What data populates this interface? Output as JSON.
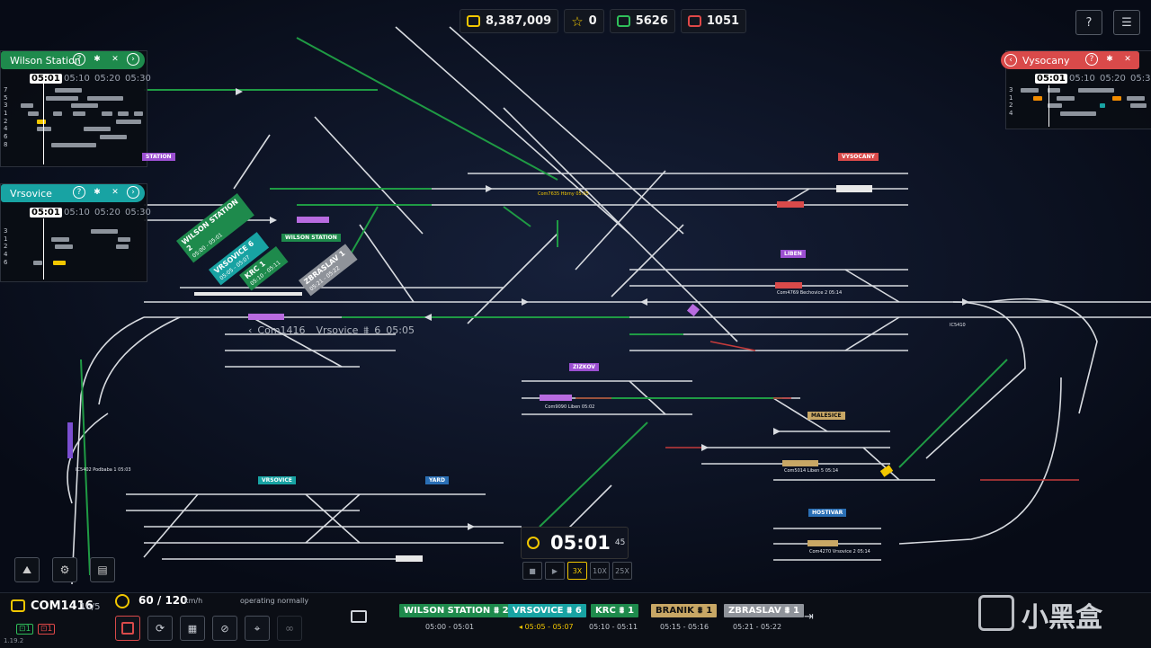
{
  "topbar": {
    "money": "8,387,009",
    "stars": "0",
    "trains_green": "5626",
    "trains_red": "1051"
  },
  "panels": {
    "wilson": {
      "title": "Wilson Station",
      "times": [
        "05:01",
        "05:10",
        "05:20",
        "05:30"
      ],
      "tracks": [
        "7",
        "5",
        "3",
        "1",
        "2",
        "4",
        "6",
        "8"
      ]
    },
    "vrsovice": {
      "title": "Vrsovice",
      "times": [
        "05:01",
        "05:10",
        "05:20",
        "05:30"
      ],
      "tracks": [
        "3",
        "1",
        "2",
        "4",
        "6"
      ]
    },
    "vysocany": {
      "title": "Vysocany",
      "times": [
        "05:01",
        "05:10",
        "05:20",
        "05:30"
      ],
      "tracks": [
        "3",
        "1",
        "2",
        "4"
      ]
    }
  },
  "map_labels": {
    "station": "STATION",
    "wilson_station": "WILSON STATION",
    "vysocany": "VYSOCANY",
    "liben": "LIBEN",
    "zizkov": "ZIZKOV",
    "malesice": "MALESICE",
    "vrsovice": "VRSOVICE",
    "yard": "YARD",
    "hostivar": "HOSTIVAR",
    "selected_train": "Com1416",
    "selected_dest": "Vrsovice",
    "selected_track": "6",
    "selected_time": "05:05",
    "tiny": [
      "Com7635 Hbrny 05:05",
      "Com4769 Bechovice 2 05:14",
      "Com9090 Liben 05:02",
      "Com5014 Liben 5 05:14",
      "Com4270 Vrsovice 2 05:14",
      "IC5410",
      "IC5402 Podbaba 1 05:03"
    ],
    "rotated_tags": [
      {
        "name": "WILSON STATION",
        "track": "2",
        "time": "05:00 - 05:01"
      },
      {
        "name": "VRSOVICE",
        "track": "6",
        "time": "05:05 - 05:07"
      },
      {
        "name": "KRC",
        "track": "1",
        "time": "05:10 - 05:11"
      },
      {
        "name": "ZBRASLAV",
        "track": "1",
        "time": "05:21 - 05:22"
      }
    ]
  },
  "clock": {
    "time": "05:01",
    "seconds": "45",
    "speeds": [
      "3X",
      "10X",
      "25X"
    ],
    "active_speed": "3X"
  },
  "bottom": {
    "train_id": "COM1416",
    "cars": "16/5",
    "count_green": "1",
    "count_red": "1",
    "speed": "60",
    "speed_max": "120",
    "speed_unit": "km/h",
    "status": "operating normally",
    "version": "1.19.2",
    "stops": [
      {
        "name": "WILSON STATION",
        "track": "2",
        "time": "05:00 - 05:01",
        "color": "#1e8a4c"
      },
      {
        "name": "VRSOVICE",
        "track": "6",
        "time": "05:05 - 05:07",
        "color": "#18a3a3"
      },
      {
        "name": "KRC",
        "track": "1",
        "time": "05:10 - 05:11",
        "color": "#1e8a4c"
      },
      {
        "name": "BRANIK",
        "track": "1",
        "time": "05:15 - 05:16",
        "color": "#c8a765"
      },
      {
        "name": "ZBRASLAV",
        "track": "1",
        "time": "05:21 - 05:22",
        "color": "#8f939a"
      }
    ]
  },
  "watermark": "小黑盒",
  "colors": {
    "green": "#1e8a4c",
    "teal": "#18a3a3",
    "red": "#d94a4a",
    "yellow": "#f2c700",
    "purple": "#9b4fd1"
  }
}
